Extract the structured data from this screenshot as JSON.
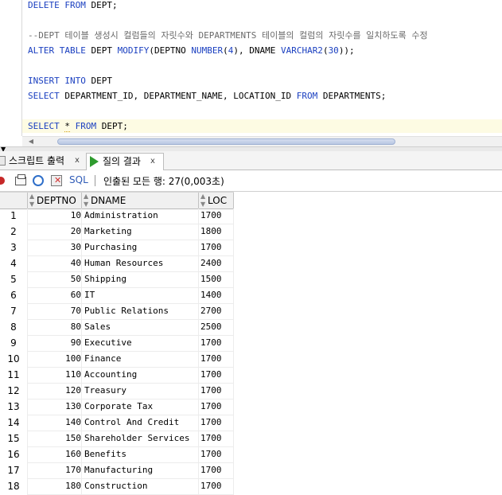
{
  "editor": {
    "lines": [
      {
        "id": "l1",
        "parts": [
          {
            "t": "DELETE FROM",
            "c": "kw"
          },
          {
            "t": " DEPT;",
            "c": ""
          }
        ]
      },
      {
        "id": "l2",
        "parts": [
          {
            "t": "--DEPT 테이블 생성시 컬럼들의 자릿수와 DEPARTMENTS 테이블의 컬럼의 자릿수를 일치하도록 수정",
            "c": "cm"
          }
        ]
      },
      {
        "id": "l3",
        "parts": [
          {
            "t": "ALTER TABLE",
            "c": "kw"
          },
          {
            "t": " DEPT ",
            "c": ""
          },
          {
            "t": "MODIFY",
            "c": "kw"
          },
          {
            "t": "(DEPTNO ",
            "c": ""
          },
          {
            "t": "NUMBER",
            "c": "kw"
          },
          {
            "t": "(",
            "c": ""
          },
          {
            "t": "4",
            "c": "num"
          },
          {
            "t": "), DNAME ",
            "c": ""
          },
          {
            "t": "VARCHAR2",
            "c": "kw"
          },
          {
            "t": "(",
            "c": ""
          },
          {
            "t": "30",
            "c": "num"
          },
          {
            "t": "));",
            "c": ""
          }
        ]
      },
      {
        "id": "l4",
        "parts": [
          {
            "t": "INSERT INTO",
            "c": "kw"
          },
          {
            "t": " DEPT",
            "c": ""
          }
        ]
      },
      {
        "id": "l5",
        "parts": [
          {
            "t": "SELECT",
            "c": "kw"
          },
          {
            "t": " DEPARTMENT_ID, DEPARTMENT_NAME, LOCATION_ID ",
            "c": ""
          },
          {
            "t": "FROM",
            "c": "kw"
          },
          {
            "t": " DEPARTMENTS;",
            "c": ""
          }
        ]
      },
      {
        "id": "l6",
        "parts": [
          {
            "t": "SELECT",
            "c": "kw"
          },
          {
            "t": " ",
            "c": ""
          },
          {
            "t": "*",
            "c": "squig"
          },
          {
            "t": " ",
            "c": ""
          },
          {
            "t": "FROM",
            "c": "kw"
          },
          {
            "t": " DEPT;",
            "c": ""
          }
        ]
      }
    ]
  },
  "tabs": {
    "script_output": {
      "label": "스크립트 출력",
      "close": "x"
    },
    "query_result": {
      "label": "질의 결과",
      "close": "x"
    }
  },
  "toolbar": {
    "sql_label": "SQL",
    "status": "인출된 모든 행: 27(0,003초)"
  },
  "grid": {
    "columns": [
      "DEPTNO",
      "DNAME",
      "LOC"
    ],
    "rows": [
      {
        "n": "1",
        "deptno": "10",
        "dname": "Administration",
        "loc": "1700"
      },
      {
        "n": "2",
        "deptno": "20",
        "dname": "Marketing",
        "loc": "1800"
      },
      {
        "n": "3",
        "deptno": "30",
        "dname": "Purchasing",
        "loc": "1700"
      },
      {
        "n": "4",
        "deptno": "40",
        "dname": "Human Resources",
        "loc": "2400"
      },
      {
        "n": "5",
        "deptno": "50",
        "dname": "Shipping",
        "loc": "1500"
      },
      {
        "n": "6",
        "deptno": "60",
        "dname": "IT",
        "loc": "1400"
      },
      {
        "n": "7",
        "deptno": "70",
        "dname": "Public Relations",
        "loc": "2700"
      },
      {
        "n": "8",
        "deptno": "80",
        "dname": "Sales",
        "loc": "2500"
      },
      {
        "n": "9",
        "deptno": "90",
        "dname": "Executive",
        "loc": "1700"
      },
      {
        "n": "10",
        "deptno": "100",
        "dname": "Finance",
        "loc": "1700"
      },
      {
        "n": "11",
        "deptno": "110",
        "dname": "Accounting",
        "loc": "1700"
      },
      {
        "n": "12",
        "deptno": "120",
        "dname": "Treasury",
        "loc": "1700"
      },
      {
        "n": "13",
        "deptno": "130",
        "dname": "Corporate Tax",
        "loc": "1700"
      },
      {
        "n": "14",
        "deptno": "140",
        "dname": "Control And Credit",
        "loc": "1700"
      },
      {
        "n": "15",
        "deptno": "150",
        "dname": "Shareholder Services",
        "loc": "1700"
      },
      {
        "n": "16",
        "deptno": "160",
        "dname": "Benefits",
        "loc": "1700"
      },
      {
        "n": "17",
        "deptno": "170",
        "dname": "Manufacturing",
        "loc": "1700"
      },
      {
        "n": "18",
        "deptno": "180",
        "dname": "Construction",
        "loc": "1700"
      }
    ]
  }
}
